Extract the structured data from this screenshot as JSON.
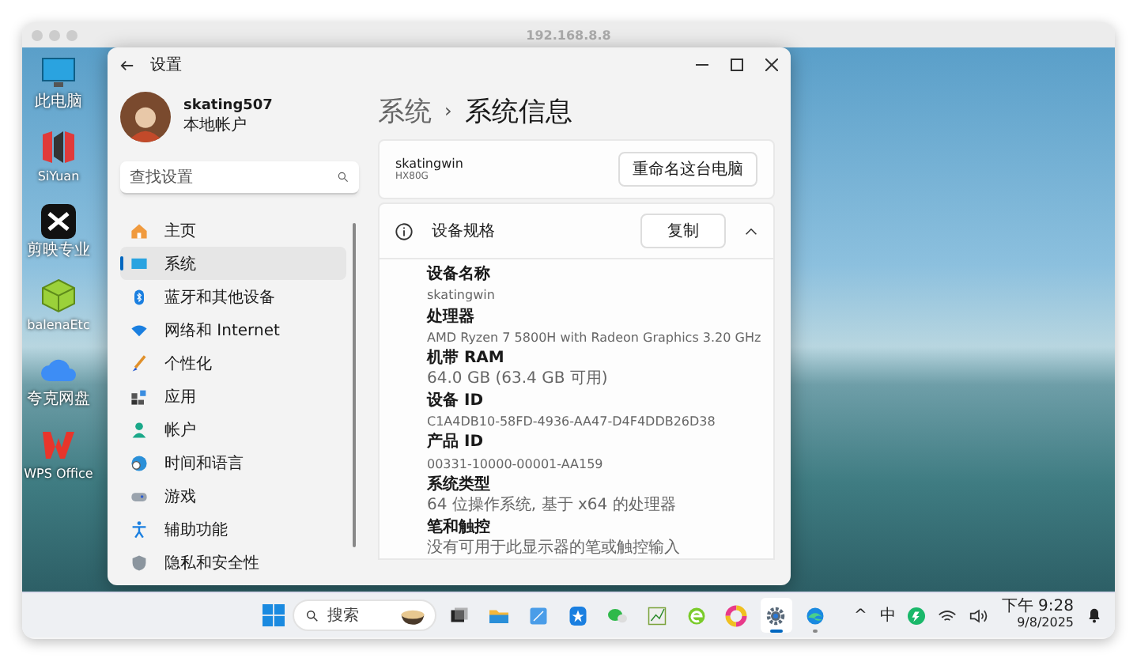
{
  "remote_window": {
    "title": "192.168.8.8"
  },
  "desktop_icons": [
    {
      "label": "此电脑"
    },
    {
      "label": "SiYuan"
    },
    {
      "label": "剪映专业"
    },
    {
      "label": "balenaEtc"
    },
    {
      "label": "夸克网盘"
    },
    {
      "label": "WPS Office"
    }
  ],
  "settings": {
    "title": "设置",
    "user": {
      "name": "skating507",
      "account_type": "本地帐户"
    },
    "search": {
      "placeholder": "查找设置"
    },
    "nav": [
      {
        "label": "主页",
        "selected": false
      },
      {
        "label": "系统",
        "selected": true
      },
      {
        "label": "蓝牙和其他设备",
        "selected": false
      },
      {
        "label": "网络和 Internet",
        "selected": false
      },
      {
        "label": "个性化",
        "selected": false
      },
      {
        "label": "应用",
        "selected": false
      },
      {
        "label": "帐户",
        "selected": false
      },
      {
        "label": "时间和语言",
        "selected": false
      },
      {
        "label": "游戏",
        "selected": false
      },
      {
        "label": "辅助功能",
        "selected": false
      },
      {
        "label": "隐私和安全性",
        "selected": false
      }
    ],
    "breadcrumb": {
      "parent": "系统",
      "separator": "›",
      "current": "系统信息"
    },
    "device": {
      "name": "skatingwin",
      "model": "HX80G",
      "rename_button": "重命名这台电脑"
    },
    "specs": {
      "title": "设备规格",
      "copy_button": "复制",
      "expanded": true,
      "items": [
        {
          "label": "设备名称",
          "value": "skatingwin"
        },
        {
          "label": "处理器",
          "value": "AMD Ryzen 7 5800H with Radeon Graphics 3.20 GHz"
        },
        {
          "label": "机带 RAM",
          "value": "64.0 GB (63.4 GB 可用)"
        },
        {
          "label": "设备 ID",
          "value": "C1A4DB10-58FD-4936-AA47-D4F4DDB26D38"
        },
        {
          "label": "产品 ID",
          "value": "00331-10000-00001-AA159"
        },
        {
          "label": "系统类型",
          "value": "64 位操作系统, 基于 x64 的处理器"
        },
        {
          "label": "笔和触控",
          "value": "没有可用于此显示器的笔或触控输入"
        }
      ]
    }
  },
  "taskbar": {
    "search": {
      "placeholder": "搜索"
    },
    "apps": [
      {
        "running": false,
        "focused": false
      },
      {
        "running": false,
        "focused": false
      },
      {
        "running": false,
        "focused": false
      },
      {
        "running": false,
        "focused": false
      },
      {
        "running": false,
        "focused": false
      },
      {
        "running": false,
        "focused": false
      },
      {
        "running": false,
        "focused": false
      },
      {
        "running": false,
        "focused": false
      },
      {
        "running": true,
        "focused": true
      },
      {
        "running": true,
        "focused": false
      }
    ],
    "tray": {
      "overflow": "^",
      "ime": "中",
      "time": "下午 9:28",
      "date": "9/8/2025"
    }
  }
}
